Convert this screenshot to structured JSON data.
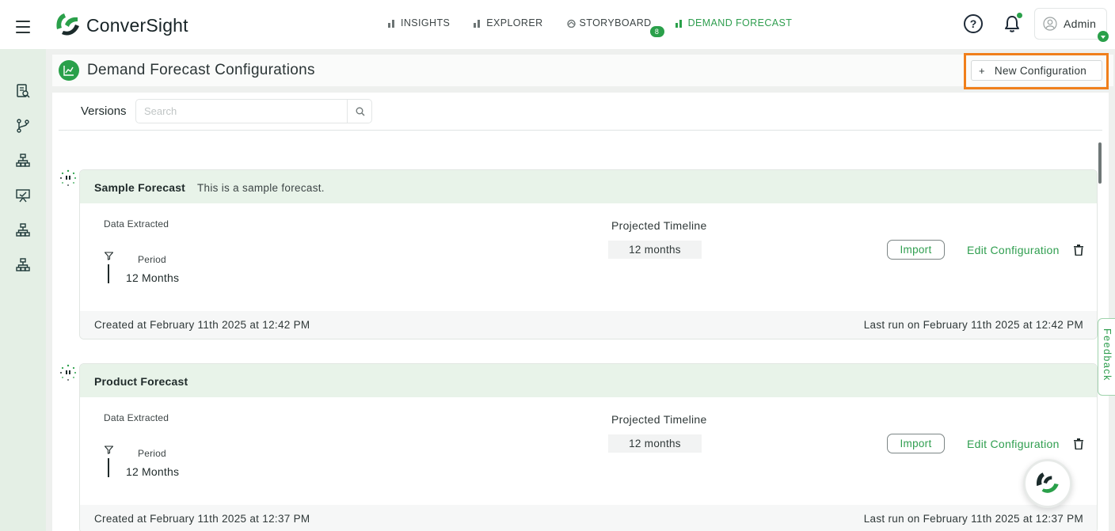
{
  "app": {
    "logo_text": "ConverSight",
    "brand_color": "#2aa04a",
    "highlight_color": "#f07f1b"
  },
  "nav": {
    "items": [
      {
        "label": "INSIGHTS",
        "icon": "bar-chart-icon"
      },
      {
        "label": "EXPLORER",
        "icon": "bar-chart-icon"
      },
      {
        "label": "STORYBOARD",
        "icon": "storyboard-icon",
        "badge": "8"
      },
      {
        "label": "DEMAND FORECAST",
        "icon": "bar-chart-icon",
        "active": true
      }
    ]
  },
  "header": {
    "help_icon": "help-circle-icon",
    "notifications_icon": "bell-icon",
    "user_name": "Admin"
  },
  "sidebar": {
    "icons": [
      "report-search-icon",
      "branch-icon",
      "hierarchy-icon",
      "presentation-check-icon",
      "hierarchy-icon",
      "hierarchy-icon"
    ]
  },
  "page": {
    "title": "Demand Forecast Configurations",
    "new_config_label": "New Configuration",
    "new_config_plus": "+"
  },
  "versions": {
    "label": "Versions",
    "search_placeholder": "Search"
  },
  "configs": [
    {
      "name": "Sample Forecast",
      "description": "This is a sample forecast.",
      "data_extracted_label": "Data Extracted",
      "period_label": "Period",
      "period_value": "12 Months",
      "timeline_label": "Projected Timeline",
      "timeline_value": "12 months",
      "import_label": "Import",
      "edit_label": "Edit Configuration",
      "created": "Created at February 11th 2025 at 12:42 PM",
      "last_run": "Last run on February 11th 2025 at 12:42 PM"
    },
    {
      "name": "Product Forecast",
      "description": "",
      "data_extracted_label": "Data Extracted",
      "period_label": "Period",
      "period_value": "12 Months",
      "timeline_label": "Projected Timeline",
      "timeline_value": "12 months",
      "import_label": "Import",
      "edit_label": "Edit Configuration",
      "created": "Created at February 11th 2025 at 12:37 PM",
      "last_run": "Last run on February 11th 2025 at 12:37 PM"
    }
  ],
  "feedback": {
    "label": "Feedback"
  }
}
